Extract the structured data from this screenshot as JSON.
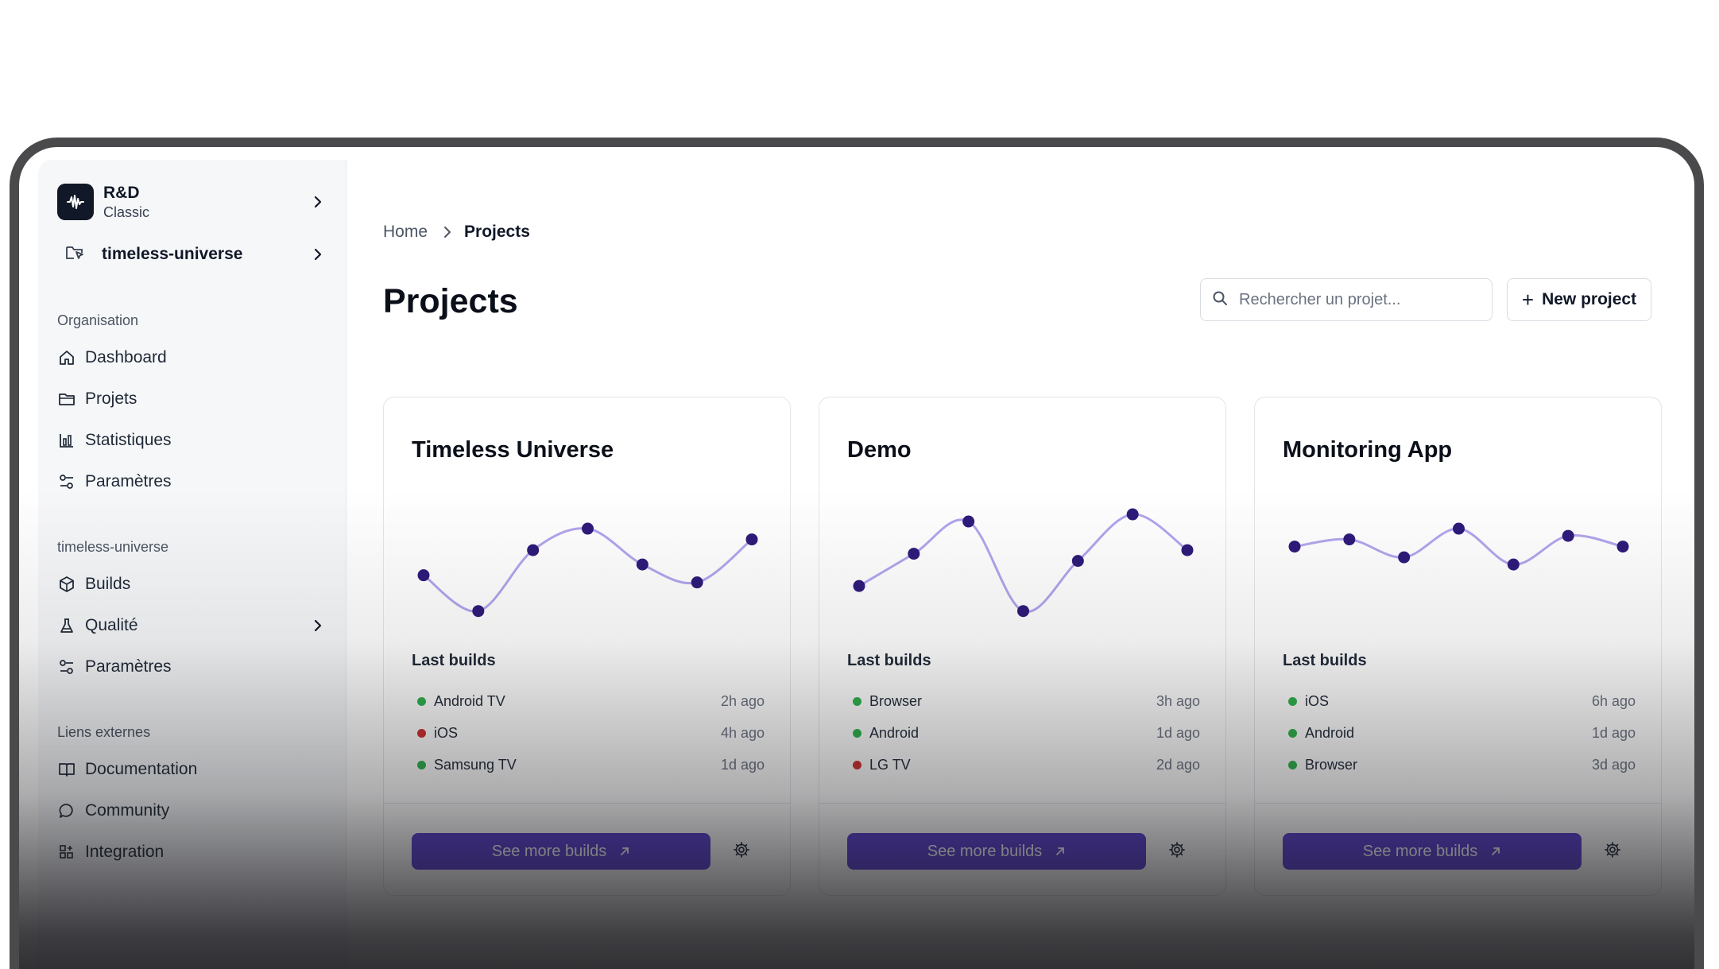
{
  "org": {
    "name": "R&D",
    "plan": "Classic"
  },
  "project_switcher": {
    "label": "timeless-universe"
  },
  "sidebar": {
    "sections": [
      {
        "title": "Organisation",
        "items": [
          {
            "label": "Dashboard",
            "icon": "home-icon"
          },
          {
            "label": "Projets",
            "icon": "folder-icon"
          },
          {
            "label": "Statistiques",
            "icon": "bar-chart-icon"
          },
          {
            "label": "Paramètres",
            "icon": "settings-sliders-icon"
          }
        ]
      },
      {
        "title": "timeless-universe",
        "items": [
          {
            "label": "Builds",
            "icon": "package-icon"
          },
          {
            "label": "Qualité",
            "icon": "flask-icon",
            "has_submenu": true
          },
          {
            "label": "Paramètres",
            "icon": "settings-sliders-icon"
          }
        ]
      },
      {
        "title": "Liens externes",
        "items": [
          {
            "label": "Documentation",
            "icon": "book-icon"
          },
          {
            "label": "Community",
            "icon": "chat-icon"
          },
          {
            "label": "Integration",
            "icon": "grid-plus-icon"
          }
        ]
      }
    ]
  },
  "breadcrumb": {
    "home": "Home",
    "current": "Projects"
  },
  "page": {
    "title": "Projects"
  },
  "search": {
    "placeholder": "Rechercher un projet..."
  },
  "new_project": {
    "label": "New project"
  },
  "colors": {
    "accent": "#5b3fd0",
    "line": "#b3a4ee",
    "point": "#2e1a7a",
    "success": "#2fb34a",
    "error": "#d32f2f"
  },
  "cards": [
    {
      "title": "Timeless Universe",
      "sparkline": [
        3.0,
        1.0,
        4.4,
        5.6,
        3.6,
        2.6,
        5.0
      ],
      "last_builds_label": "Last builds",
      "builds": [
        {
          "name": "Android TV",
          "time": "2h ago",
          "status": "success"
        },
        {
          "name": "iOS",
          "time": "4h ago",
          "status": "error"
        },
        {
          "name": "Samsung TV",
          "time": "1d ago",
          "status": "success"
        }
      ],
      "see_more_label": "See more builds"
    },
    {
      "title": "Demo",
      "sparkline": [
        2.4,
        4.2,
        6.0,
        1.0,
        3.8,
        6.4,
        4.4
      ],
      "last_builds_label": "Last builds",
      "builds": [
        {
          "name": "Browser",
          "time": "3h ago",
          "status": "success"
        },
        {
          "name": "Android",
          "time": "1d ago",
          "status": "success"
        },
        {
          "name": "LG TV",
          "time": "2d ago",
          "status": "error"
        }
      ],
      "see_more_label": "See more builds"
    },
    {
      "title": "Monitoring App",
      "sparkline": [
        4.6,
        5.0,
        4.0,
        5.6,
        3.6,
        5.2,
        4.6
      ],
      "last_builds_label": "Last builds",
      "builds": [
        {
          "name": "iOS",
          "time": "6h ago",
          "status": "success"
        },
        {
          "name": "Android",
          "time": "1d ago",
          "status": "success"
        },
        {
          "name": "Browser",
          "time": "3d ago",
          "status": "success"
        }
      ],
      "see_more_label": "See more builds"
    }
  ]
}
